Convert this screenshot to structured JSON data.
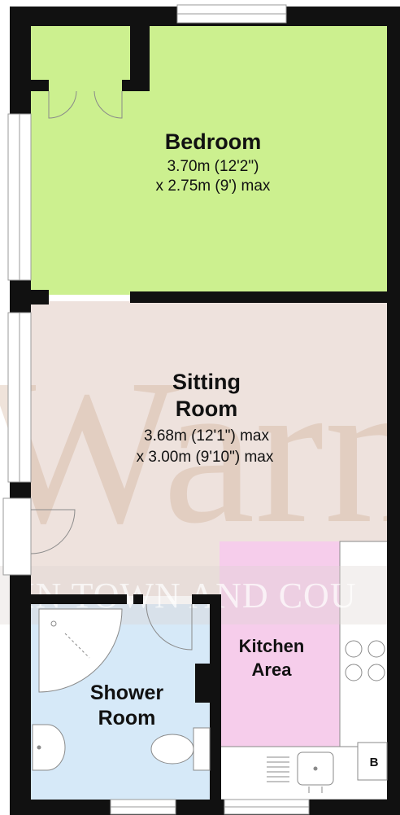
{
  "watermark": {
    "brand": "Warne",
    "tagline": "IN TOWN AND COU"
  },
  "rooms": {
    "bedroom": {
      "name": "Bedroom",
      "dim1": "3.70m (12'2\")",
      "dim2": "x 2.75m (9') max",
      "color": "#ccf08f"
    },
    "sitting_room": {
      "name_line1": "Sitting",
      "name_line2": "Room",
      "dim1": "3.68m (12'1\") max",
      "dim2": "x 3.00m (9'10\") max",
      "color": "#eee2dd"
    },
    "kitchen": {
      "name_line1": "Kitchen",
      "name_line2": "Area",
      "color": "#f6cdeb"
    },
    "shower_room": {
      "name_line1": "Shower",
      "name_line2": "Room",
      "color": "#d6e9f8"
    }
  },
  "fixtures": {
    "boiler_label": "B"
  },
  "colors": {
    "wall": "#111111",
    "window_frame": "#9a9a9a"
  }
}
